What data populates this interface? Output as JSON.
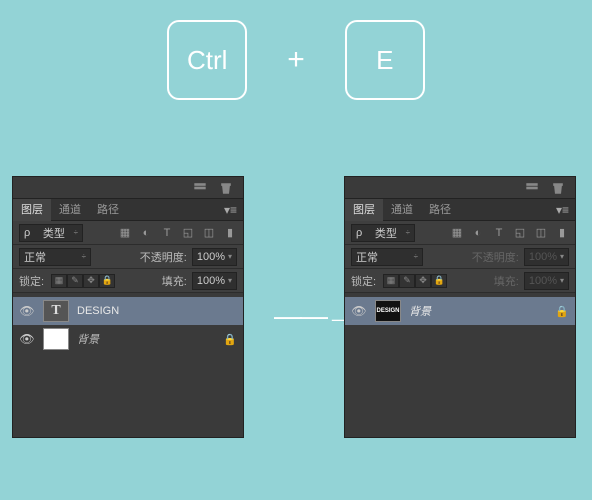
{
  "keys": {
    "ctrl": "Ctrl",
    "plus": "+",
    "e": "E"
  },
  "arrow": "——→",
  "panel": {
    "tabs": {
      "layers": "图层",
      "channels": "通道",
      "paths": "路径"
    },
    "filter": {
      "label": "类型",
      "prefix": "ρ"
    },
    "blend": {
      "mode": "正常",
      "opacity_label": "不透明度:",
      "opacity_value": "100%"
    },
    "lock": {
      "label": "锁定:",
      "fill_label": "填充:",
      "fill_value": "100%"
    }
  },
  "left_layers": [
    {
      "thumb_text": "T",
      "name": "DESIGN",
      "selected": true,
      "locked": false,
      "italic": false
    },
    {
      "thumb_text": "",
      "name": "背景",
      "selected": false,
      "locked": true,
      "italic": true
    }
  ],
  "right_layers": [
    {
      "thumb_text": "DESIGN",
      "name": "背景",
      "selected": true,
      "locked": true,
      "italic": true
    }
  ]
}
